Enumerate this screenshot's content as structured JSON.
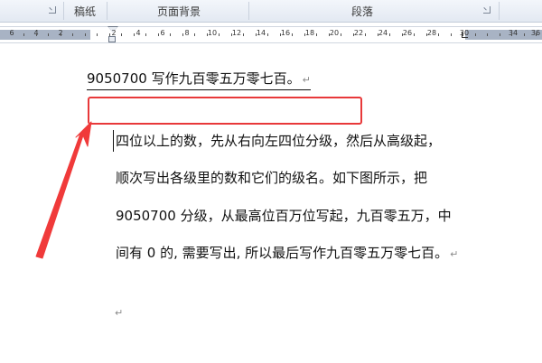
{
  "ribbon": {
    "groups": [
      {
        "label": "稿纸"
      },
      {
        "label": "页面背景"
      },
      {
        "label": "段落"
      }
    ]
  },
  "ruler": {
    "numbers": [
      "6",
      "4",
      "2",
      "2",
      "4",
      "6",
      "8",
      "10",
      "12",
      "14",
      "16",
      "18",
      "20",
      "22",
      "24",
      "26",
      "28",
      "30",
      "34",
      "36"
    ]
  },
  "document": {
    "heading": "9050700 写作九百零五万零七百。",
    "paragraph_mark": "↵",
    "lines": [
      "四位以上的数，先从右向左四位分级，然后从高级起，",
      "顺次写出各级里的数和它们的级名。如下图所示，把",
      "9050700 分级，从最高位百万位写起，九百零五万，中",
      "间有 0 的, 需要写出, 所以最后写作九百零五万零七百。"
    ]
  },
  "annotation": {
    "box_color": "#e8393a",
    "arrow_color": "#f03a3a"
  }
}
